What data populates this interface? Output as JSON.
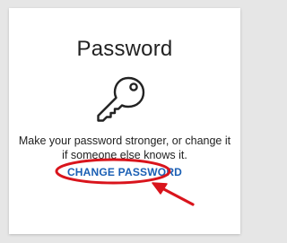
{
  "card": {
    "title": "Password",
    "description": "Make your password stronger, or change it if someone else knows it.",
    "link_label": "CHANGE PASSWORD",
    "key_icon": "key-icon"
  },
  "colors": {
    "background": "#e6e6e6",
    "card": "#ffffff",
    "link": "#1a5fb4",
    "annotation": "#d9141c"
  }
}
